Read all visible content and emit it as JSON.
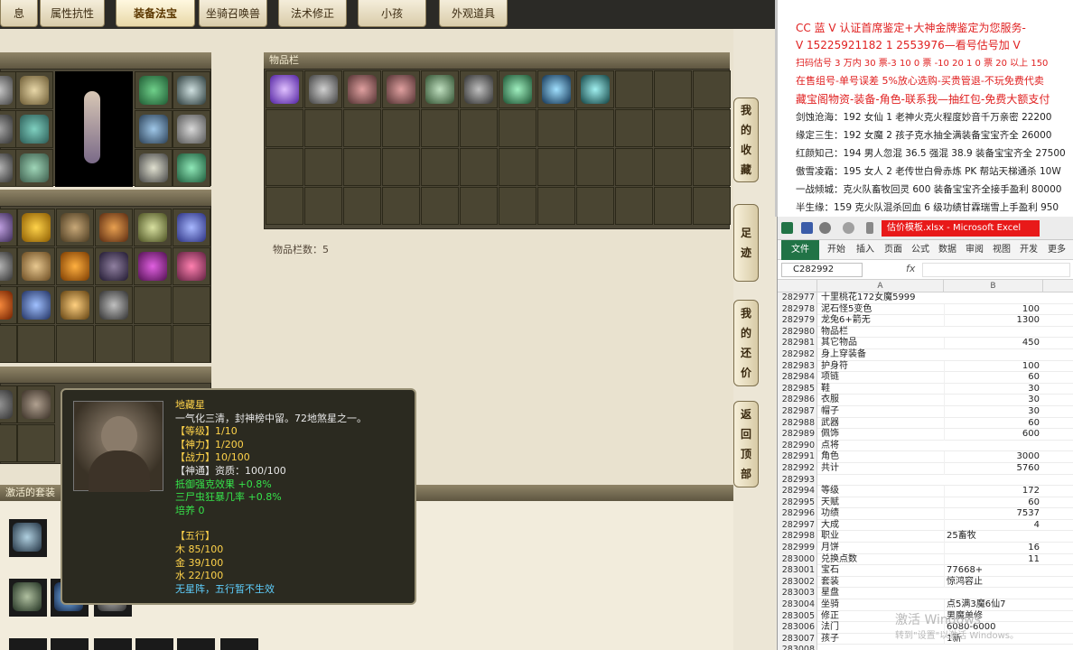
{
  "game": {
    "tabs": [
      {
        "label": "息"
      },
      {
        "label": "属性抗性"
      },
      {
        "label": "装备法宝",
        "active": true
      },
      {
        "label": "坐骑召唤兽"
      },
      {
        "label": "法术修正"
      },
      {
        "label": "小孩"
      },
      {
        "label": "外观道具"
      }
    ],
    "section_equipment": "",
    "section_left2": "",
    "section_star": "",
    "section_suit": "激活的套装",
    "bag_title": "物品栏",
    "bag_count": "物品栏数：5",
    "side_buttons": [
      {
        "chars": [
          "我",
          "的",
          "收",
          "藏"
        ]
      },
      {
        "chars": [
          "足",
          "迹"
        ]
      },
      {
        "chars": [
          "我",
          "的",
          "还",
          "价"
        ]
      },
      {
        "chars": [
          "返",
          "回",
          "顶",
          "部"
        ]
      }
    ],
    "tooltip": {
      "name": "地藏星",
      "desc": "一气化三清，封神榜中留。72地煞星之一。",
      "level": "【等级】1/10",
      "shenli": "【神力】1/200",
      "zhanli": "【战力】10/100",
      "shentong": "【神通】资质：100/100",
      "effect1": "抵御强克效果 +0.8%",
      "effect2": "三尸虫狂暴几率 +0.8%",
      "peiyang": "培养 0",
      "wuxing_title": "【五行】",
      "wood": "木 85/100",
      "metal": "金 39/100",
      "water": "水 22/100",
      "note": "无星阵，五行暂不生效"
    }
  },
  "stream": {
    "lines": [
      {
        "text": "CC 蓝 V 认证首席鉴定+大神金牌鉴定为您服务-",
        "color": "#e02020"
      },
      {
        "text": "V 15225921182      1 2553976—看号估号加 V",
        "color": "#e02020"
      },
      {
        "text": "扫码估号 3 万内 30 票-3 10 0 票 -10 20 1 0 票 20 以上 150",
        "color": "#e02020"
      },
      {
        "text": "在售组号-单号误差 5%放心选购-买贵管退-不玩免费代卖",
        "color": "#e02020"
      },
      {
        "text": "藏宝阁物资-装备-角色-联系我—抽红包-免费大额支付",
        "color": "#e02020"
      },
      {
        "text": "剑蚀沧海：192 女仙 1 老神火克火程度妙音千万亲密 22200",
        "color": "#222222"
      },
      {
        "text": "缘定三生：192 女魔 2 孩子克水抽全满装备宝宝齐全 26000",
        "color": "#222222"
      },
      {
        "text": "红颜知己：194 男人忽混 36.5 强混 38.9 装备宝宝齐全 27500",
        "color": "#222222"
      },
      {
        "text": "傲雪凌霜：195 女人 2 老传世白骨赤炼 PK 帮站天梯通杀 10W",
        "color": "#222222"
      },
      {
        "text": "一战倾城：克火队畜牧回灵 600 装备宝宝齐全接手盈利 80000",
        "color": "#222222"
      },
      {
        "text": "半生缘：159 克火队混杀回血 6 级功绩甘霖瑞雪上手盈利 950",
        "color": "#222222"
      }
    ]
  },
  "excel": {
    "title": "估价模板.xlsx - Microsoft Excel",
    "tabs": [
      "文件",
      "开始",
      "插入",
      "页面",
      "公式",
      "数据",
      "审阅",
      "视图",
      "开发",
      "更多"
    ],
    "namebox": "C282992",
    "fx": "fx",
    "col_a": "A",
    "col_b": "B",
    "rows": [
      {
        "n": "282977",
        "a": "十里桃花172女魔5999",
        "b": ""
      },
      {
        "n": "282978",
        "a": "泥石怪5变色",
        "b": "100"
      },
      {
        "n": "282979",
        "a": "龙兔6+箭无",
        "b": "1300"
      },
      {
        "n": "282980",
        "a": "物品栏",
        "b": ""
      },
      {
        "n": "282981",
        "a": "其它物品",
        "b": "450"
      },
      {
        "n": "282982",
        "a": "身上穿装备",
        "b": ""
      },
      {
        "n": "282983",
        "a": "护身符",
        "b": "100"
      },
      {
        "n": "282984",
        "a": "项链",
        "b": "60"
      },
      {
        "n": "282985",
        "a": "鞋",
        "b": "30"
      },
      {
        "n": "282986",
        "a": "衣服",
        "b": "30"
      },
      {
        "n": "282987",
        "a": "帽子",
        "b": "30"
      },
      {
        "n": "282988",
        "a": "武器",
        "b": "60"
      },
      {
        "n": "282989",
        "a": "佩饰",
        "b": "600"
      },
      {
        "n": "282990",
        "a": "点将",
        "b": ""
      },
      {
        "n": "282991",
        "a": "角色",
        "b": "3000"
      },
      {
        "n": "282992",
        "a": "共计",
        "b": "5760"
      },
      {
        "n": "282993",
        "a": "",
        "b": ""
      },
      {
        "n": "282994",
        "a": "等级",
        "b": "172"
      },
      {
        "n": "282995",
        "a": "天赋",
        "b": "60"
      },
      {
        "n": "282996",
        "a": "功绩",
        "b": "7537"
      },
      {
        "n": "282997",
        "a": "大成",
        "b": "4"
      },
      {
        "n": "282998",
        "a": "职业",
        "b": "25畜牧",
        "bl": true
      },
      {
        "n": "282999",
        "a": "月饼",
        "b": "16"
      },
      {
        "n": "283000",
        "a": "兑换点数",
        "b": "11"
      },
      {
        "n": "283001",
        "a": "宝石",
        "b": "77668+",
        "bl": true
      },
      {
        "n": "283002",
        "a": "套装",
        "b": "惊鸿容止",
        "bl": true
      },
      {
        "n": "283003",
        "a": "星盘",
        "b": "",
        "bl": true
      },
      {
        "n": "283004",
        "a": "坐骑",
        "b": "点5满3魔6仙7",
        "bl": true
      },
      {
        "n": "283005",
        "a": "修正",
        "b": "男魔单修",
        "bl": true
      },
      {
        "n": "283006",
        "a": "法门",
        "b": "6080-6000",
        "bl": true
      },
      {
        "n": "283007",
        "a": "孩子",
        "b": "1新",
        "bl": true
      },
      {
        "n": "283008",
        "a": "",
        "b": ""
      }
    ],
    "watermark1": "激活 Windows",
    "watermark2": "转到\"设置\"以激活 Windows。"
  }
}
